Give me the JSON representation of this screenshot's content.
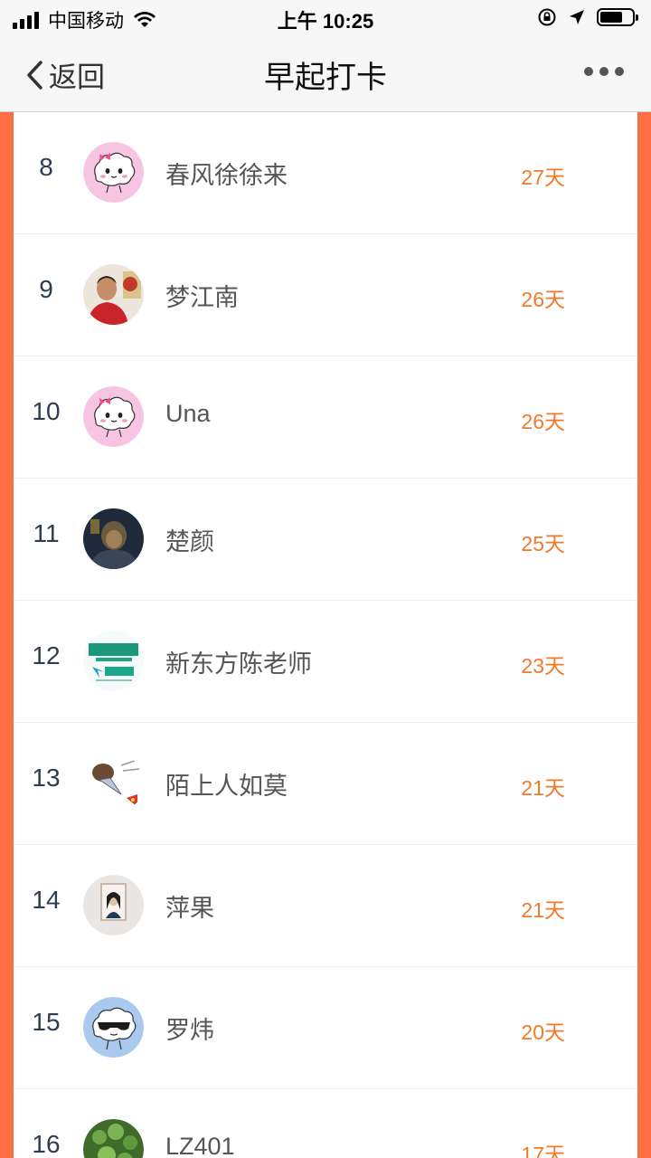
{
  "status_bar": {
    "carrier": "中国移动",
    "time": "上午 10:25"
  },
  "nav": {
    "back_label": "返回",
    "title": "早起打卡"
  },
  "colors": {
    "accent": "#ff6f44",
    "days_text": "#f07a2a"
  },
  "rows": [
    {
      "rank": "8",
      "name": "春风徐徐来",
      "days": "27天",
      "avatar": "cloud-pink-avatar"
    },
    {
      "rank": "9",
      "name": "梦江南",
      "days": "26天",
      "avatar": "photo-avatar"
    },
    {
      "rank": "10",
      "name": "Una",
      "days": "26天",
      "avatar": "cloud-pink-avatar"
    },
    {
      "rank": "11",
      "name": "楚颜",
      "days": "25天",
      "avatar": "dark-photo-avatar"
    },
    {
      "rank": "12",
      "name": "新东方陈老师",
      "days": "23天",
      "avatar": "xdf-logo-avatar"
    },
    {
      "rank": "13",
      "name": "陌上人如莫",
      "days": "21天",
      "avatar": "cartoon-avatar"
    },
    {
      "rank": "14",
      "name": "萍果",
      "days": "21天",
      "avatar": "portrait-avatar"
    },
    {
      "rank": "15",
      "name": "罗炜",
      "days": "20天",
      "avatar": "cloud-sunglasses-avatar"
    },
    {
      "rank": "16",
      "name": "LZ401",
      "days": "17天",
      "avatar": "plant-avatar"
    }
  ]
}
